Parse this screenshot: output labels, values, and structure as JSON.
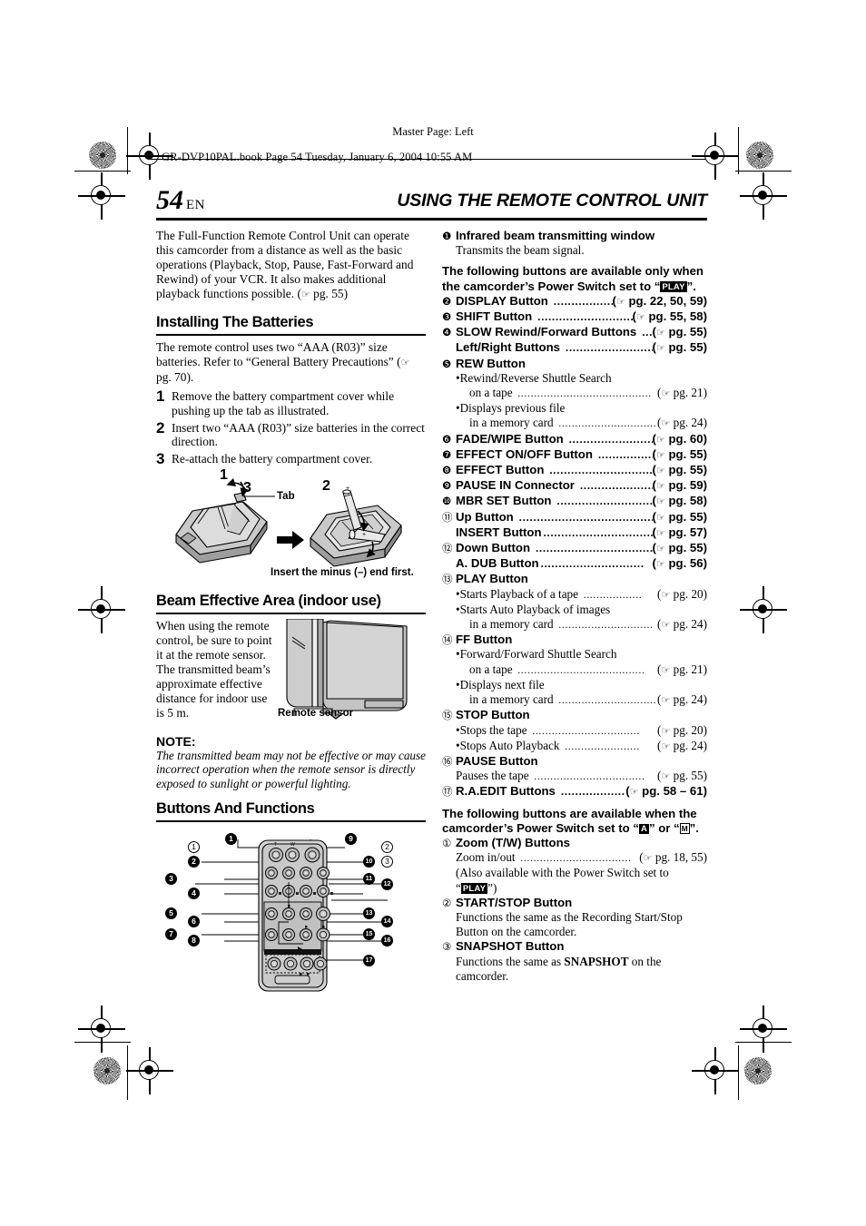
{
  "print_marks": {
    "master_page": "Master Page: Left",
    "book_line": "GR-DVP10PAL.book  Page 54  Tuesday, January 6, 2004  10:55 AM"
  },
  "header": {
    "page_number": "54",
    "page_lang": "EN",
    "chapter_title": "USING THE REMOTE CONTROL UNIT"
  },
  "left_column": {
    "intro": "The Full-Function Remote Control Unit can operate this camcorder from a distance as well as the basic operations (Playback, Stop, Pause, Fast-Forward and Rewind) of your VCR. It also makes additional playback functions possible. (",
    "intro_ref": " pg. 55)",
    "section_batteries": {
      "heading": "Installing The Batteries",
      "intro_a": "The remote control uses two “AAA (R03)” size batteries. Refer to “General Battery Precautions” (",
      "intro_b": " pg. 70).",
      "steps": [
        {
          "n": "1",
          "text": "Remove the battery compartment cover while pushing up the tab as illustrated."
        },
        {
          "n": "2",
          "text": "Insert two “AAA (R03)” size batteries in the correct direction."
        },
        {
          "n": "3",
          "text": "Re-attach the battery compartment cover."
        }
      ],
      "figure_labels": {
        "one": "1",
        "two": "2",
        "three": "3",
        "tab": "Tab",
        "caption": "Insert the minus (–) end first."
      }
    },
    "section_beam": {
      "heading": "Beam Effective Area (indoor use)",
      "text": "When using the remote control, be sure to point it at the remote sensor. The transmitted beam’s approximate effective distance for indoor use is 5 m.",
      "image_label": "Remote sensor",
      "note_heading": "NOTE:",
      "note_text": "The transmitted beam may not be effective or may cause incorrect operation when the remote sensor is directly exposed to sunlight or powerful lighting."
    },
    "section_buttons": {
      "heading": "Buttons And Functions",
      "callouts_filled": [
        "1",
        "2",
        "3",
        "4",
        "5",
        "6",
        "7",
        "8",
        "9",
        "10",
        "11",
        "12",
        "13",
        "14",
        "15",
        "16",
        "17"
      ],
      "callouts_open": [
        "1",
        "2",
        "3"
      ]
    }
  },
  "right_column": {
    "item1": {
      "num": "1",
      "title": "Infrared beam transmitting window",
      "desc": "Transmits the beam signal."
    },
    "play_group_heading_a": "The following buttons are available only when the camcorder’s Power Switch set to “",
    "play_group_heading_b": "”.",
    "play_badge": "PLAY",
    "play_items": [
      {
        "num": "2",
        "label": "DISPLAY Button",
        "ref": "pg. 22, 50, 59",
        "bold_ref": true
      },
      {
        "num": "3",
        "label": "SHIFT Button",
        "ref": "pg. 55, 58",
        "bold_ref": true
      },
      {
        "num": "4",
        "label": "SLOW Rewind/Forward Buttons",
        "ref": "pg. 55",
        "bold_ref": true,
        "sub_label": "Left/Right Buttons",
        "sub_ref": "pg. 55"
      },
      {
        "num": "5",
        "label": "REW Button",
        "bullets": [
          {
            "text": "Rewind/Reverse Shuttle Search",
            "cont": "on a tape",
            "ref": "pg. 21"
          },
          {
            "text": "Displays previous file",
            "cont": "in a memory card",
            "ref": "pg. 24"
          }
        ]
      },
      {
        "num": "6",
        "label": "FADE/WIPE Button",
        "ref": "pg. 60",
        "bold_ref": true
      },
      {
        "num": "7",
        "label": "EFFECT ON/OFF Button",
        "ref": "pg. 55",
        "bold_ref": true
      },
      {
        "num": "8",
        "label": "EFFECT Button",
        "ref": "pg. 55",
        "bold_ref": true
      },
      {
        "num": "9",
        "label": "PAUSE IN Connector",
        "ref": "pg. 59",
        "bold_ref": true
      },
      {
        "num": "10",
        "label": "MBR SET Button",
        "ref": "pg. 58",
        "bold_ref": true
      },
      {
        "num": "11",
        "label": "Up Button",
        "ref": "pg. 55",
        "bold_ref": true,
        "sub_label": "INSERT Button",
        "sub_ref": "pg. 57"
      },
      {
        "num": "12",
        "label": "Down Button",
        "ref": "pg. 55",
        "bold_ref": true,
        "sub_label": "A. DUB Button",
        "sub_ref": "pg. 56"
      },
      {
        "num": "13",
        "label": "PLAY Button",
        "bullets": [
          {
            "text": "Starts Playback of a tape",
            "ref": "pg. 20"
          },
          {
            "text": "Starts Auto Playback of images",
            "cont": "in a memory card",
            "ref": "pg. 24"
          }
        ]
      },
      {
        "num": "14",
        "label": "FF Button",
        "bullets": [
          {
            "text": "Forward/Forward Shuttle Search",
            "cont": "on a tape",
            "ref": "pg. 21"
          },
          {
            "text": "Displays next file",
            "cont": "in a memory card",
            "ref": "pg. 24"
          }
        ]
      },
      {
        "num": "15",
        "label": "STOP Button",
        "bullets": [
          {
            "text": "Stops the tape",
            "ref": "pg. 20"
          },
          {
            "text": "Stops Auto Playback",
            "ref": "pg. 24"
          }
        ]
      },
      {
        "num": "16",
        "label": "PAUSE Button",
        "plain": [
          {
            "text": "Pauses the tape",
            "ref": "pg. 55"
          }
        ]
      },
      {
        "num": "17",
        "label": "R.A.EDIT Buttons",
        "ref": "pg. 58 – 61",
        "bold_ref": true
      }
    ],
    "auto_group_heading_a": "The following buttons are available when the camcorder’s Power Switch set to “",
    "auto_group_heading_mid": "” or “",
    "auto_group_heading_b": "”.",
    "badge_auto": "A",
    "badge_manual": "M",
    "auto_items": [
      {
        "num": "1",
        "label": "Zoom (T/W) Buttons",
        "desc_lead": "Zoom in/out",
        "ref": "pg. 18, 55",
        "extra1": "(Also available with the Power Switch set to",
        "extra2_a": "“",
        "extra2_badge": "PLAY",
        "extra2_b": "”)"
      },
      {
        "num": "2",
        "label": "START/STOP Button",
        "desc": "Functions the same as the Recording Start/Stop Button on the camcorder."
      },
      {
        "num": "3",
        "label": "SNAPSHOT Button",
        "desc_a": "Functions the same as ",
        "desc_bold": "SNAPSHOT",
        "desc_b": " on the camcorder."
      }
    ]
  },
  "colors": {
    "ink": "#000000",
    "paper": "#ffffff",
    "illustration_light": "#d9d9d9",
    "illustration_mid": "#b4b4b4",
    "illustration_dark": "#8c8c8c"
  }
}
